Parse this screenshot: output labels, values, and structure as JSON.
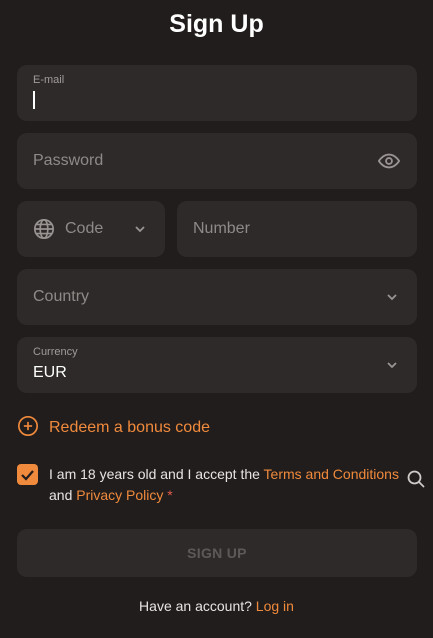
{
  "title": "Sign Up",
  "email": {
    "label": "E-mail",
    "value": ""
  },
  "password": {
    "placeholder": "Password",
    "icon": "eye-icon"
  },
  "phone": {
    "code_placeholder": "Code",
    "number_placeholder": "Number",
    "icon": "globe-icon"
  },
  "country": {
    "placeholder": "Country"
  },
  "currency": {
    "label": "Currency",
    "value": "EUR"
  },
  "redeem": {
    "label": "Redeem a bonus code",
    "icon": "plus-circle-icon"
  },
  "terms": {
    "checked": true,
    "text_before": "I am 18 years old and I accept the ",
    "terms_link": "Terms and Conditions",
    "and_text": "and ",
    "privacy_link": "Privacy Policy",
    "asterisk": "*"
  },
  "signup_button": {
    "label": "SIGN UP"
  },
  "footer": {
    "question": "Have an account?",
    "login_link": "Log in"
  },
  "colors": {
    "background": "#211d1c",
    "field": "#2e2a29",
    "accent": "#f08a3c",
    "placeholder": "#8f8a88"
  }
}
